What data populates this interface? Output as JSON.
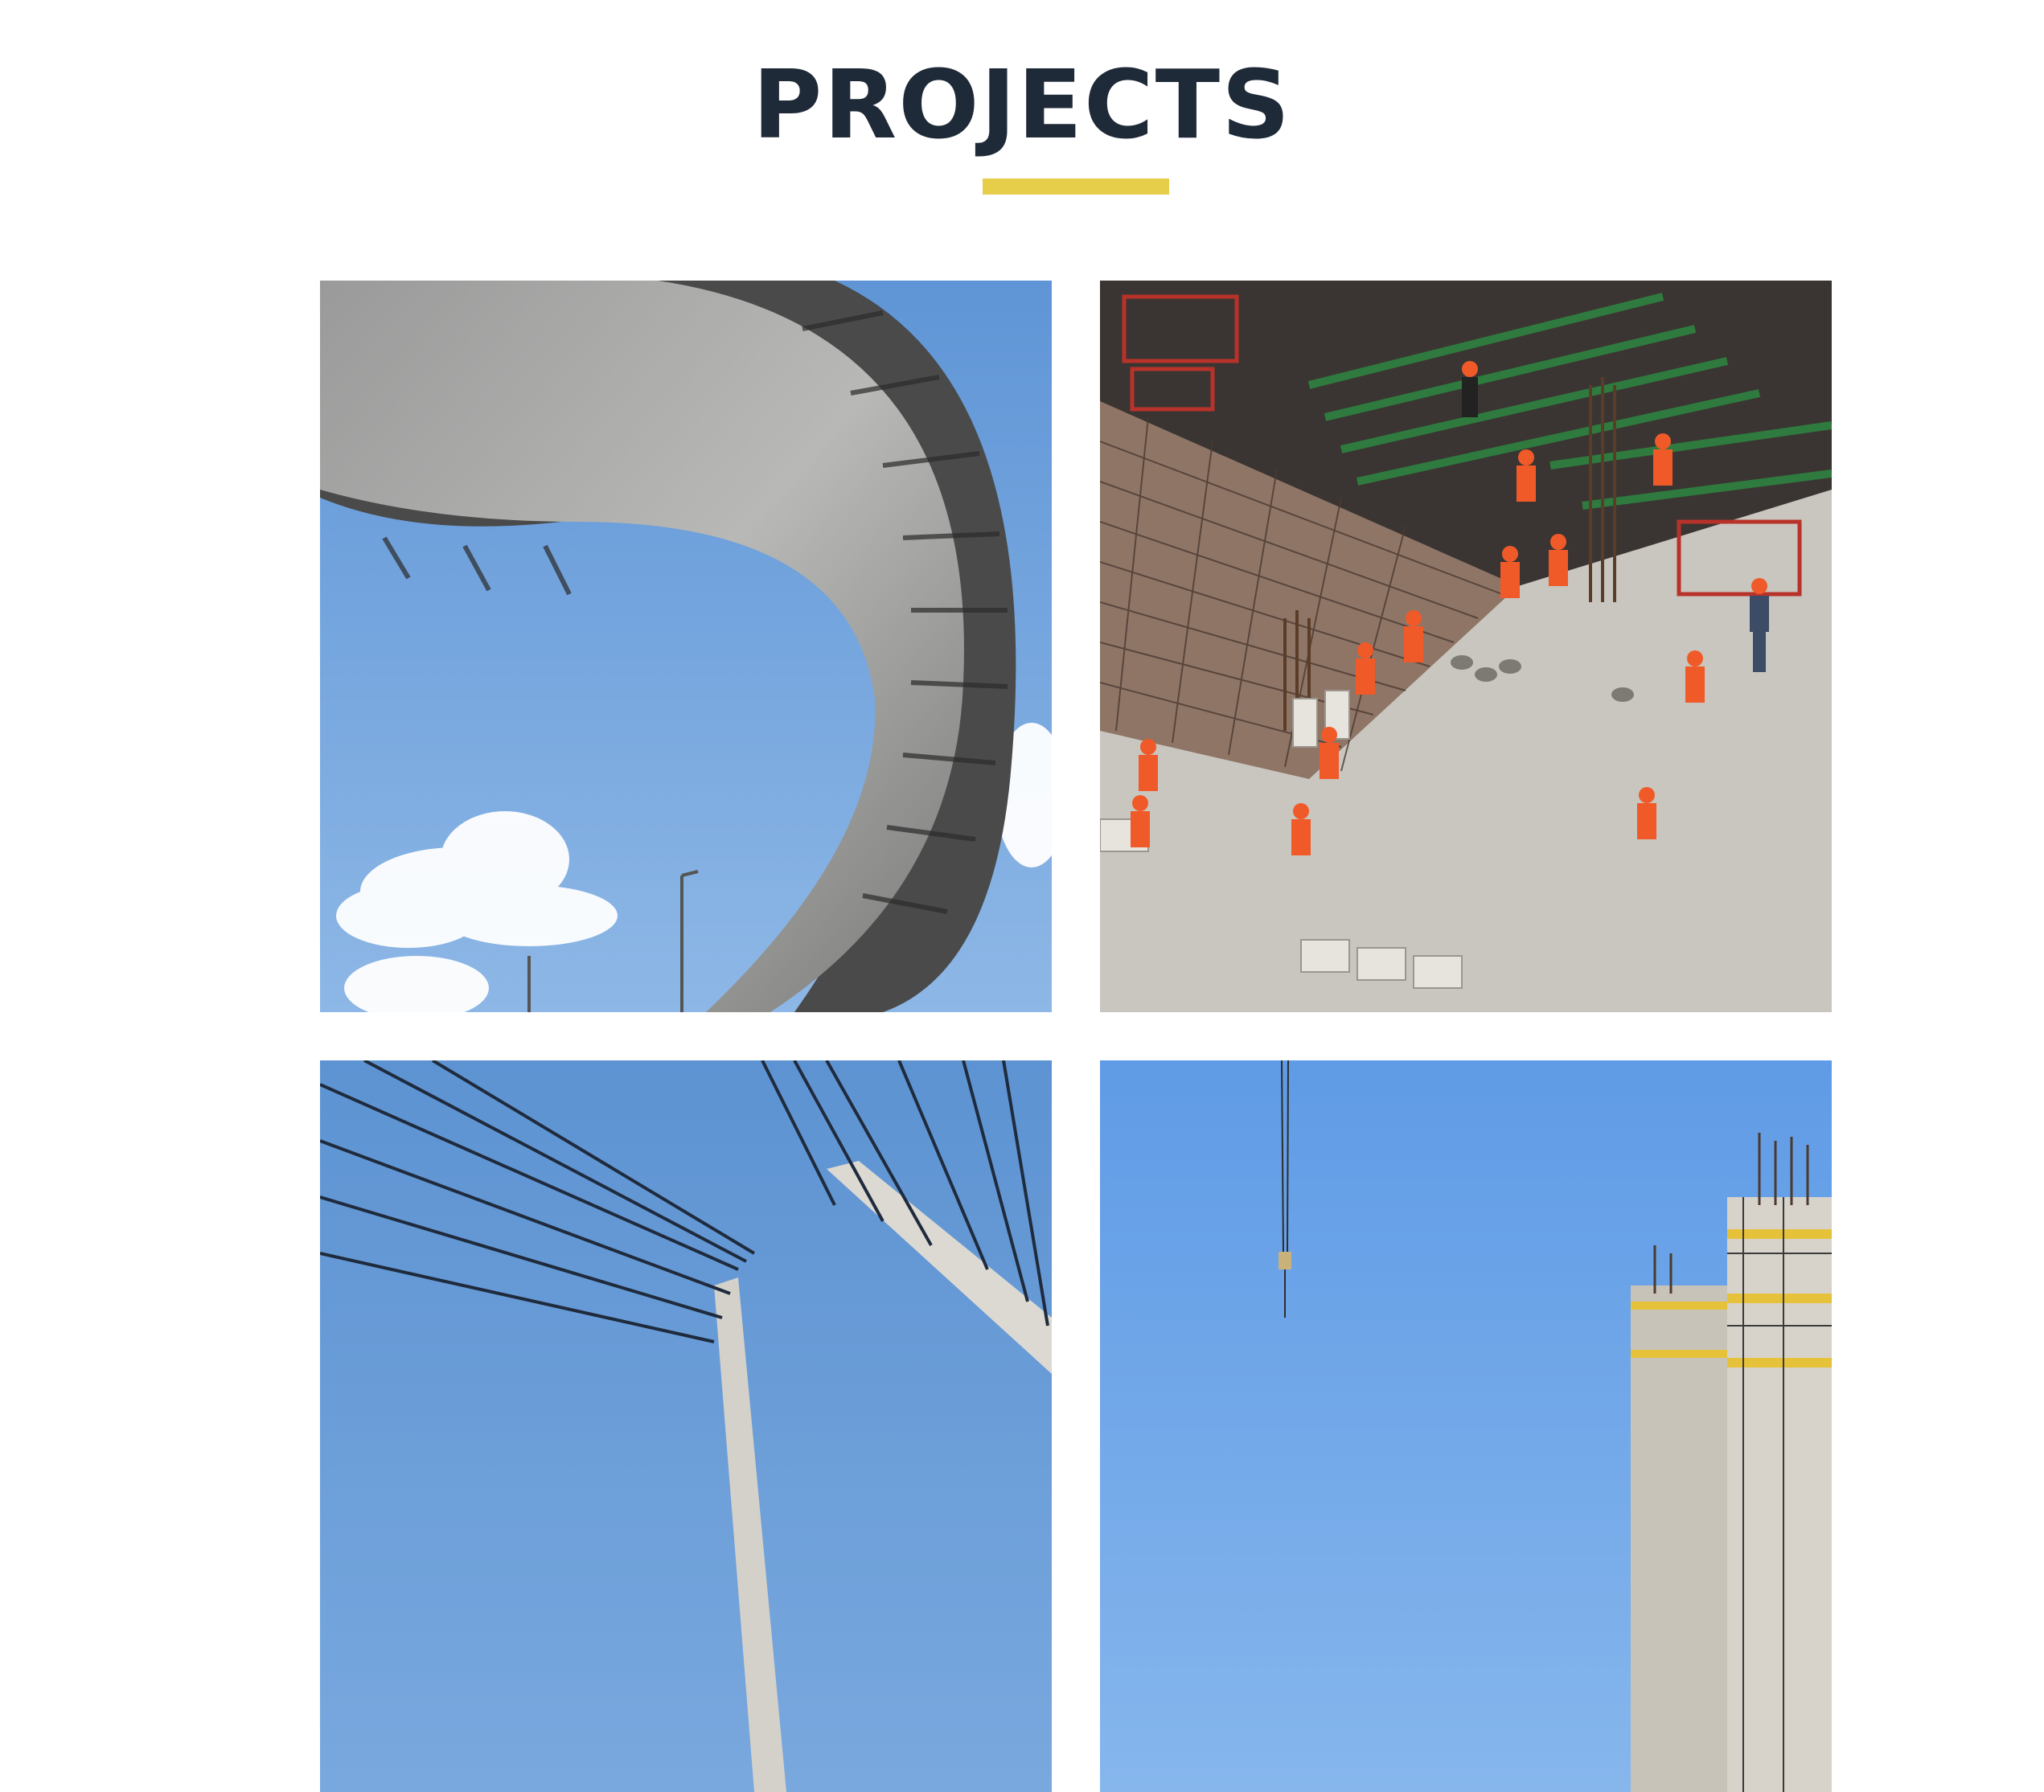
{
  "page": {
    "title": "PROJECTS"
  },
  "colors": {
    "title": "#1f2a38",
    "underline": "#e6cd4a",
    "sky": "#6fa2dc",
    "concrete": "#bdbab4",
    "safety_orange": "#f05a28"
  },
  "projects": [
    {
      "image": "curved-elevated-highway"
    },
    {
      "image": "construction-site-workers"
    },
    {
      "image": "cable-stayed-bridge"
    },
    {
      "image": "crane-building-construction"
    }
  ]
}
